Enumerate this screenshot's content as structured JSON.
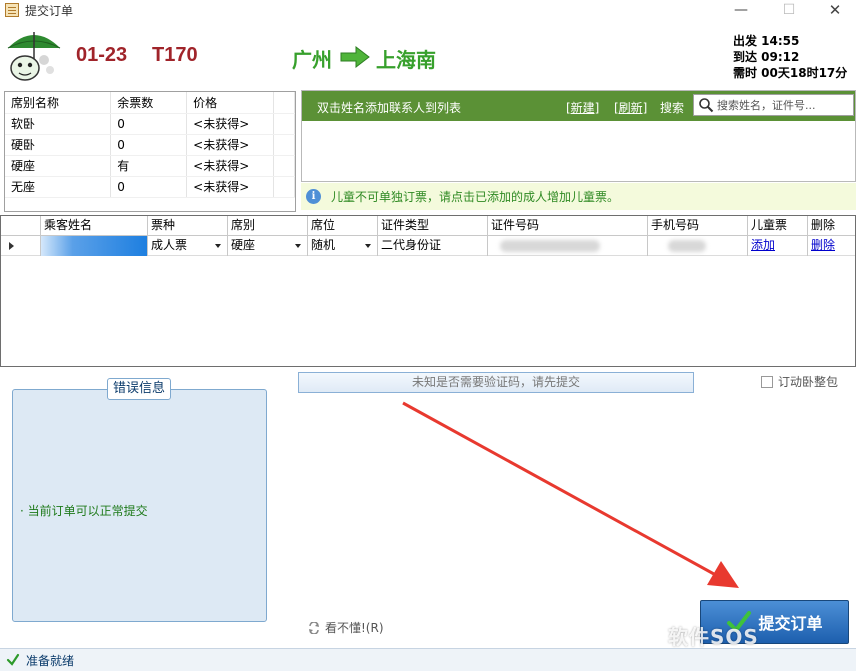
{
  "window": {
    "title": "提交订单",
    "controls": {
      "minimize": "—",
      "maximize": "☐",
      "close": "✕"
    }
  },
  "header": {
    "date": "01-23",
    "train_no": "T170",
    "from": "广州",
    "to": "上海南",
    "depart": "出发 14:55",
    "arrive": "到达 09:12",
    "duration": "需时 00天18时17分"
  },
  "seat_table": {
    "headers": [
      "席别名称",
      "余票数",
      "价格"
    ],
    "rows": [
      {
        "name": "软卧",
        "count": "0",
        "price": "<未获得>"
      },
      {
        "name": "硬卧",
        "count": "0",
        "price": "<未获得>"
      },
      {
        "name": "硬座",
        "count": "有",
        "price": "<未获得>"
      },
      {
        "name": "无座",
        "count": "0",
        "price": "<未获得>"
      }
    ]
  },
  "contacts": {
    "hint": "双击姓名添加联系人到列表",
    "new_link": "[新建]",
    "refresh_link": "[刷新]",
    "search_label": "搜索",
    "search_placeholder": "搜索姓名，证件号..."
  },
  "notice": "儿童不可单独订票，请点击已添加的成人增加儿童票。",
  "passenger_grid": {
    "headers": [
      "乘客姓名",
      "票种",
      "席别",
      "席位",
      "证件类型",
      "证件号码",
      "手机号码",
      "儿童票",
      "删除"
    ],
    "row": {
      "name": "",
      "ticket_type": "成人票",
      "seat_class": "硬座",
      "seat_position": "随机",
      "id_type": "二代身份证",
      "id_number": "",
      "phone": "",
      "child_action": "添加",
      "delete_action": "删除"
    }
  },
  "error_panel": {
    "title": "错误信息",
    "message": "· 当前订单可以正常提交"
  },
  "captcha_bar": "未知是否需要验证码，请先提交",
  "sleeper_checkbox": "订动卧整包",
  "help_link": "看不懂!(R)",
  "submit_label": "提交订单",
  "watermark": "软件SOS",
  "status": "准备就绪",
  "colors": {
    "accent_red": "#a0242a",
    "station_green": "#37a02c",
    "panel_green": "#5b9136",
    "button_blue": "#1d5fae"
  }
}
